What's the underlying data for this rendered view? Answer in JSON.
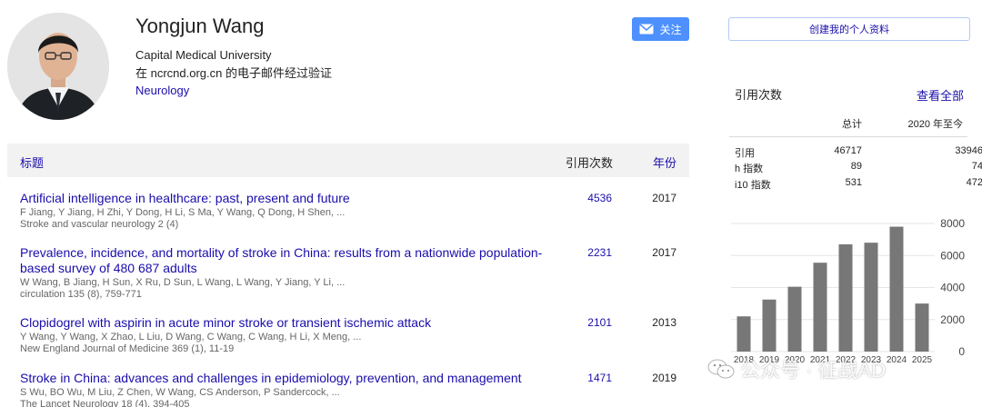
{
  "profile": {
    "name": "Yongjun Wang",
    "affiliation": "Capital Medical University",
    "email_verified": "在 ncrcnd.org.cn 的电子邮件经过验证",
    "interest": "Neurology",
    "follow_label": "关注"
  },
  "table": {
    "header_title": "标题",
    "header_cited": "引用次数",
    "header_year": "年份"
  },
  "articles": [
    {
      "title": "Artificial intelligence in healthcare: past, present and future",
      "authors": "F Jiang, Y Jiang, H Zhi, Y Dong, H Li, S Ma, Y Wang, Q Dong, H Shen, ...",
      "venue": "Stroke and vascular neurology 2 (4)",
      "cited": "4536",
      "year": "2017"
    },
    {
      "title": "Prevalence, incidence, and mortality of stroke in China: results from a nationwide population-based survey of 480 687 adults",
      "authors": "W Wang, B Jiang, H Sun, X Ru, D Sun, L Wang, L Wang, Y Jiang, Y Li, ...",
      "venue": "circulation 135 (8), 759-771",
      "cited": "2231",
      "year": "2017"
    },
    {
      "title": "Clopidogrel with aspirin in acute minor stroke or transient ischemic attack",
      "authors": "Y Wang, Y Wang, X Zhao, L Liu, D Wang, C Wang, C Wang, H Li, X Meng, ...",
      "venue": "New England Journal of Medicine 369 (1), 11-19",
      "cited": "2101",
      "year": "2013"
    },
    {
      "title": "Stroke in China: advances and challenges in epidemiology, prevention, and management",
      "authors": "S Wu, BO Wu, M Liu, Z Chen, W Wang, CS Anderson, P Sandercock, ...",
      "venue": "The Lancet Neurology 18 (4), 394-405",
      "cited": "1471",
      "year": "2019"
    }
  ],
  "sidebar": {
    "create_profile_label": "创建我的个人资料",
    "cited_by_title": "引用次数",
    "view_all_label": "查看全部",
    "col_all": "总计",
    "col_since": "2020 年至今",
    "stats": [
      {
        "label": "引用",
        "all": "46717",
        "since": "33946"
      },
      {
        "label": "h 指数",
        "all": "89",
        "since": "74"
      },
      {
        "label": "i10 指数",
        "all": "531",
        "since": "472"
      }
    ]
  },
  "chart_data": {
    "type": "bar",
    "categories": [
      "2018",
      "2019",
      "2020",
      "2021",
      "2022",
      "2023",
      "2024",
      "2025"
    ],
    "values": [
      2200,
      3250,
      4050,
      5550,
      6700,
      6800,
      7800,
      3000
    ],
    "ylim": [
      0,
      8000
    ],
    "yticks": [
      "0",
      "2000",
      "4000",
      "6000",
      "8000"
    ],
    "bar_color": "#777777",
    "grid": true
  },
  "watermark": {
    "text": "公众号 · 征战AD"
  },
  "colors": {
    "link": "#1a0dab",
    "button": "#4d90fe"
  }
}
